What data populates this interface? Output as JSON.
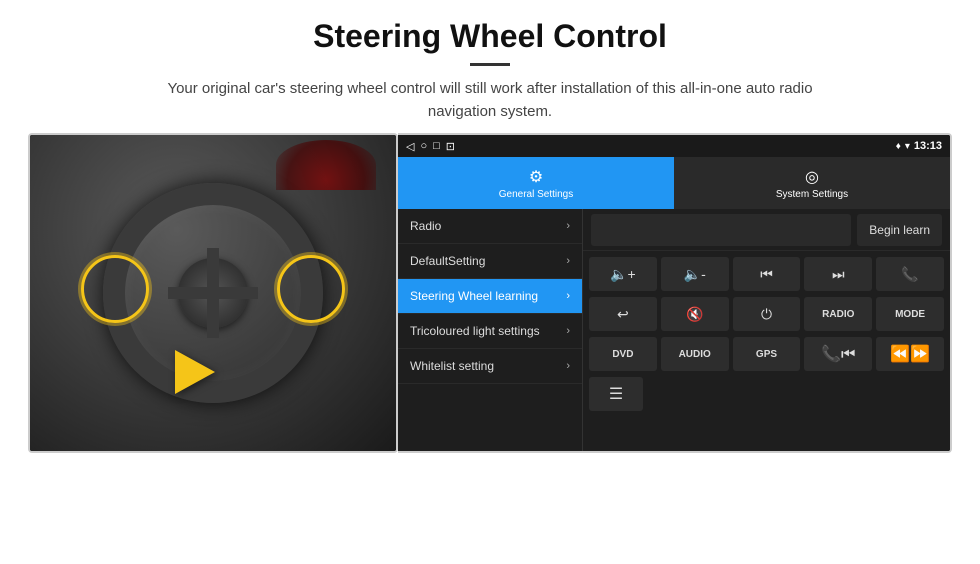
{
  "header": {
    "title": "Steering Wheel Control",
    "divider": true,
    "subtitle": "Your original car's steering wheel control will still work after installation of this all-in-one auto radio navigation system."
  },
  "status_bar": {
    "back_icon": "◁",
    "home_icon": "○",
    "recents_icon": "□",
    "cast_icon": "⊡",
    "location_icon": "♦",
    "wifi_icon": "▾",
    "time": "13:13"
  },
  "tabs": [
    {
      "id": "general",
      "label": "General Settings",
      "icon": "⚙",
      "active": true
    },
    {
      "id": "system",
      "label": "System Settings",
      "icon": "◎",
      "active": false
    }
  ],
  "menu_items": [
    {
      "id": "radio",
      "label": "Radio",
      "active": false
    },
    {
      "id": "default_setting",
      "label": "DefaultSetting",
      "active": false
    },
    {
      "id": "steering_wheel",
      "label": "Steering Wheel learning",
      "active": true
    },
    {
      "id": "tricoloured",
      "label": "Tricoloured light settings",
      "active": false
    },
    {
      "id": "whitelist",
      "label": "Whitelist setting",
      "active": false
    }
  ],
  "begin_learn_label": "Begin learn",
  "control_buttons": {
    "row1": [
      {
        "icon": "🔇+",
        "type": "icon",
        "label": "vol-up"
      },
      {
        "icon": "🔇-",
        "type": "icon",
        "label": "vol-down"
      },
      {
        "icon": "⏮",
        "type": "icon",
        "label": "prev-track"
      },
      {
        "icon": "⏭",
        "type": "icon",
        "label": "next-track"
      },
      {
        "icon": "📞",
        "type": "icon",
        "label": "phone"
      }
    ],
    "row2": [
      {
        "icon": "↩",
        "type": "icon",
        "label": "back"
      },
      {
        "icon": "🔇×",
        "type": "icon",
        "label": "mute"
      },
      {
        "icon": "⏻",
        "type": "icon",
        "label": "power"
      },
      {
        "text": "RADIO",
        "type": "text",
        "label": "radio-btn"
      },
      {
        "text": "MODE",
        "type": "text",
        "label": "mode-btn"
      }
    ],
    "row3": [
      {
        "text": "DVD",
        "type": "text",
        "label": "dvd-btn"
      },
      {
        "text": "AUDIO",
        "type": "text",
        "label": "audio-btn"
      },
      {
        "text": "GPS",
        "type": "text",
        "label": "gps-btn"
      },
      {
        "icon": "📞⏮",
        "type": "icon",
        "label": "call-prev"
      },
      {
        "icon": "⏮⏭",
        "type": "icon",
        "label": "seek"
      }
    ],
    "row4_icon": "≡",
    "row4_label": "menu-icon-btn"
  }
}
